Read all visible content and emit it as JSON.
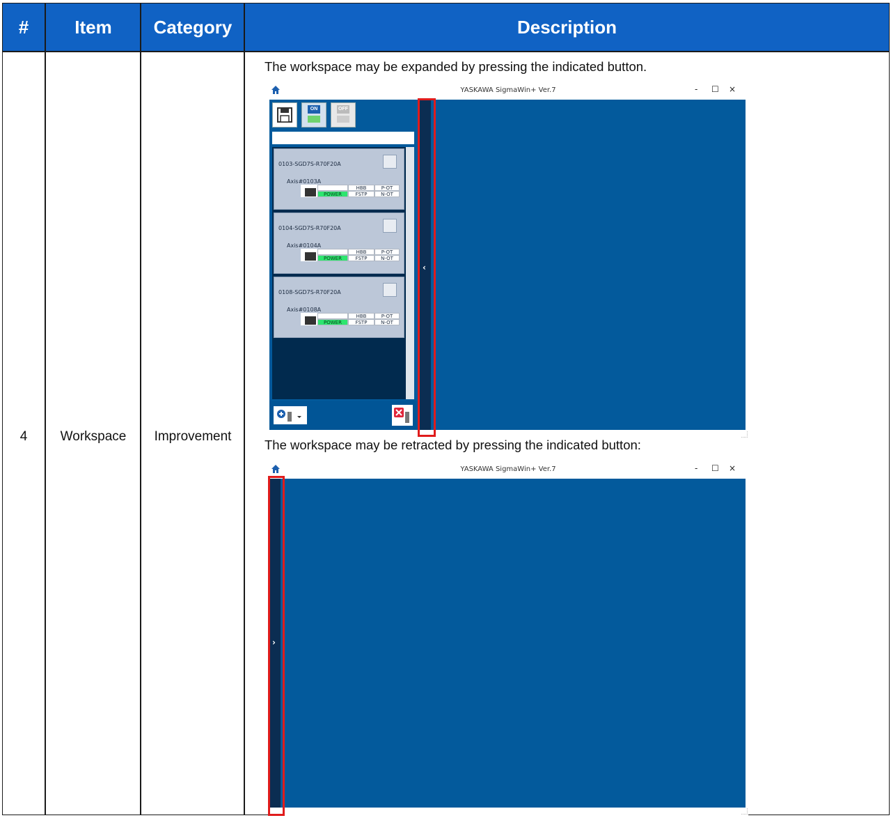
{
  "table": {
    "headers": [
      "#",
      "Item",
      "Category",
      "Description"
    ],
    "row": {
      "number": "4",
      "item": "Workspace",
      "category": "Improvement",
      "description_expanded": "The workspace may be expanded by pressing the indicated button.",
      "description_retracted": "The workspace may be retracted by pressing the indicated button:"
    }
  },
  "window": {
    "title": "YASKAWA SigmaWin+ Ver.7",
    "minimize": "-",
    "maximize": "☐",
    "close": "×",
    "toolbar": {
      "on_label": "ON",
      "off_label": "OFF"
    },
    "devices": [
      {
        "name": "0103-SGD7S-R70F20A",
        "axis": "Axis#0103A"
      },
      {
        "name": "0104-SGD7S-R70F20A",
        "axis": "Axis#0104A"
      },
      {
        "name": "0108-SGD7S-R70F20A",
        "axis": "Axis#0108A"
      }
    ],
    "status_labels": {
      "power": "POWER",
      "hbb": "HBB",
      "fstp": "FSTP",
      "pot": "P-OT",
      "not": "N-OT"
    },
    "collapse_glyph": "‹",
    "expand_glyph": "›"
  },
  "colors": {
    "header_blue": "#1062c4",
    "workspace_blue": "#035a9c",
    "panel_navy": "#012a4e",
    "highlight_red": "#e01c1c",
    "power_green": "#2ee56f"
  }
}
